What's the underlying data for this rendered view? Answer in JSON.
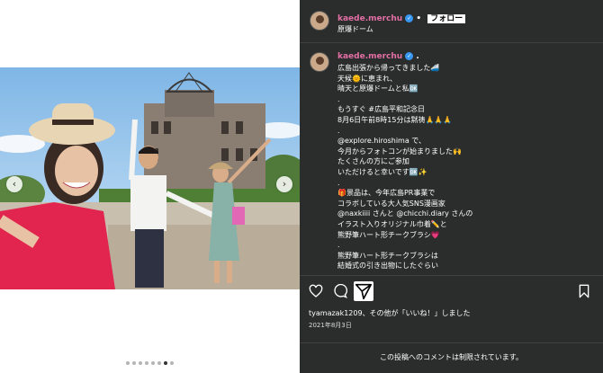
{
  "header": {
    "username": "kaede.merchu",
    "verified_glyph": "✓",
    "follow_label": "フォロー",
    "location": "原爆ドーム"
  },
  "caption": {
    "username": "kaede.merchu",
    "lines": [
      "広島出張から帰ってきました🚄",
      "天候🌞に恵まれ、",
      "晴天と原爆ドームと私🆗",
      ".",
      "もうすぐ #広島平和記念日",
      "8月6日午前8時15分は黙祷🙏🙏🙏",
      ".",
      "@explore.hiroshima で、",
      "今月からフォトコンが始まりました🙌",
      "たくさんの方にご参加",
      "いただけると幸いです🆗✨",
      ".",
      "🎁景品は、今年広島PR事業で",
      "コラボしている大人気SNS漫画家",
      "@naxkiiii さんと @chicchi.diary さんの",
      "イラスト入りオリジナル巾着✏️と",
      "熊野筆ハート形チークブラシ💗",
      ".",
      "熊野筆ハート形チークブラシは",
      "結婚式の引き出物にしたぐらい"
    ]
  },
  "media": {
    "prev_glyph": "‹",
    "next_glyph": "›",
    "carousel_count": 8,
    "carousel_active_index": 6
  },
  "actions": {
    "like": "heart-icon",
    "comment": "comment-icon",
    "share": "paper-plane-icon",
    "save": "bookmark-icon"
  },
  "likes_text": "tyamazak1209、その他が「いいね！」しました",
  "date": "2021年8月3日",
  "comments_disabled": "この投稿へのコメントは制限されています。",
  "colors": {
    "panel": "#2b2c2c",
    "username": "#e26fa5",
    "verified": "#3897f0"
  }
}
